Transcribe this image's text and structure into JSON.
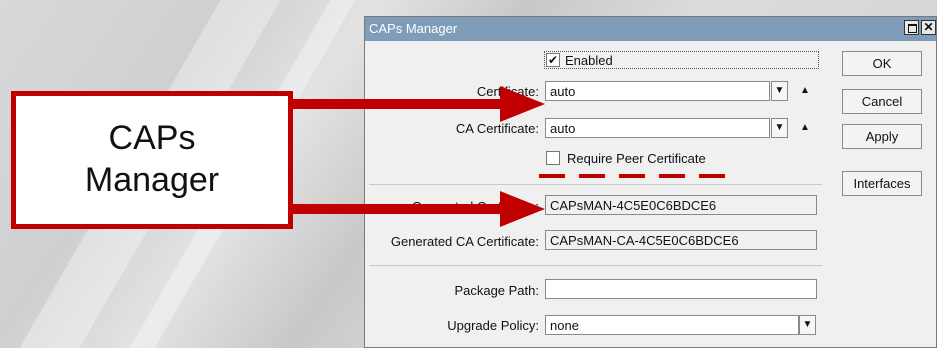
{
  "window": {
    "title": "CAPs Manager",
    "close_glyph": "✕"
  },
  "enabled": {
    "label": "Enabled",
    "checked": true
  },
  "certificate": {
    "label": "Certificate:",
    "value": "auto"
  },
  "ca_certificate": {
    "label": "CA Certificate:",
    "value": "auto"
  },
  "require_peer": {
    "label": "Require Peer Certificate",
    "checked": false
  },
  "generated_certificate": {
    "label": "Generated Certificate:",
    "value": "CAPsMAN-4C5E0C6BDCE6"
  },
  "generated_ca_certificate": {
    "label": "Generated CA Certificate:",
    "value": "CAPsMAN-CA-4C5E0C6BDCE6"
  },
  "package_path": {
    "label": "Package Path:",
    "value": ""
  },
  "upgrade_policy": {
    "label": "Upgrade Policy:",
    "value": "none"
  },
  "buttons": {
    "ok": "OK",
    "cancel": "Cancel",
    "apply": "Apply",
    "interfaces": "Interfaces"
  },
  "glyphs": {
    "dropdown": "▼",
    "up": "▲",
    "check": "✔"
  },
  "callout": {
    "line1": "CAPs",
    "line2": "Manager"
  },
  "colors": {
    "annotation": "#c00000",
    "titlebar": "#7f9db9"
  }
}
